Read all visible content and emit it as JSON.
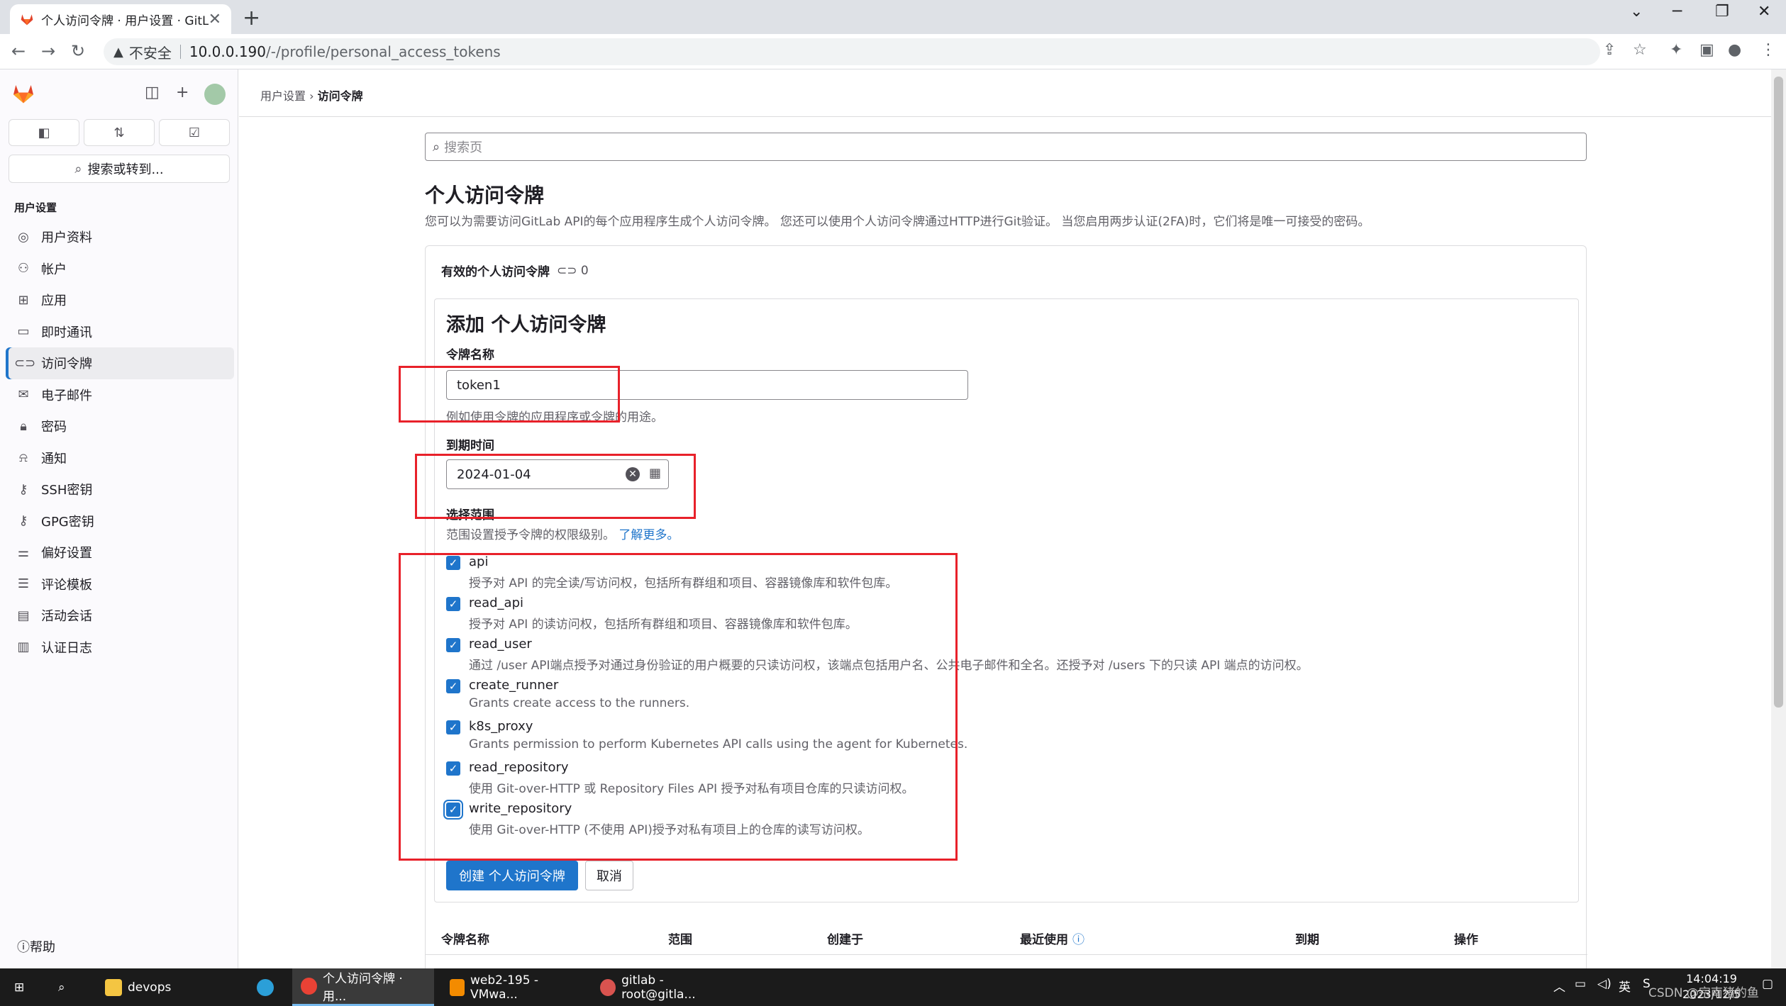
{
  "browser": {
    "tab_title": "个人访问令牌 · 用户设置 · GitLa",
    "tab_close": "✕",
    "new_tab": "+",
    "security_label": "不安全",
    "url_host": "10.0.0.190",
    "url_path": "/-/profile/personal_access_tokens"
  },
  "sidebar": {
    "search_label": "搜索或转到...",
    "section_title": "用户设置",
    "items": [
      {
        "label": "用户资料",
        "icon": "profile-icon"
      },
      {
        "label": "帐户",
        "icon": "account-icon"
      },
      {
        "label": "应用",
        "icon": "applications-icon"
      },
      {
        "label": "即时通讯",
        "icon": "chat-icon"
      },
      {
        "label": "访问令牌",
        "icon": "token-icon"
      },
      {
        "label": "电子邮件",
        "icon": "email-icon"
      },
      {
        "label": "密码",
        "icon": "lock-icon"
      },
      {
        "label": "通知",
        "icon": "bell-icon"
      },
      {
        "label": "SSH密钥",
        "icon": "key-icon"
      },
      {
        "label": "GPG密钥",
        "icon": "key-icon"
      },
      {
        "label": "偏好设置",
        "icon": "preferences-icon"
      },
      {
        "label": "评论模板",
        "icon": "comment-template-icon"
      },
      {
        "label": "活动会话",
        "icon": "sessions-icon"
      },
      {
        "label": "认证日志",
        "icon": "log-icon"
      }
    ],
    "active_index": 4,
    "help_label": "帮助"
  },
  "main": {
    "breadcrumb": {
      "parent": "用户设置",
      "current": "访问令牌"
    },
    "search_placeholder": "搜索页",
    "title": "个人访问令牌",
    "description": "您可以为需要访问GitLab API的每个应用程序生成个人访问令牌。 您还可以使用个人访问令牌通过HTTP进行Git验证。 当您启用两步认证(2FA)时，它们将是唯一可接受的密码。",
    "active_tokens_label": "有效的个人访问令牌",
    "active_tokens_count": "0",
    "form": {
      "title": "添加 个人访问令牌",
      "name_label": "令牌名称",
      "name_value": "token1",
      "name_help": "例如使用令牌的应用程序或令牌的用途。",
      "expiry_label": "到期时间",
      "expiry_value": "2024-01-04",
      "scopes_label": "选择范围",
      "scopes_help": "范围设置授予令牌的权限级别。",
      "scopes_link": "了解更多。",
      "scopes": [
        {
          "name": "api",
          "desc": "授予对 API 的完全读/写访问权，包括所有群组和项目、容器镜像库和软件包库。",
          "checked": true
        },
        {
          "name": "read_api",
          "desc": "授予对 API 的读访问权，包括所有群组和项目、容器镜像库和软件包库。",
          "checked": true
        },
        {
          "name": "read_user",
          "desc": "通过 /user API端点授予对通过身份验证的用户概要的只读访问权，该端点包括用户名、公共电子邮件和全名。还授予对 /users 下的只读 API 端点的访问权。",
          "checked": true
        },
        {
          "name": "create_runner",
          "desc": "Grants create access to the runners.",
          "checked": true
        },
        {
          "name": "k8s_proxy",
          "desc": "Grants permission to perform Kubernetes API calls using the agent for Kubernetes.",
          "checked": true
        },
        {
          "name": "read_repository",
          "desc": "使用 Git-over-HTTP 或 Repository Files API 授予对私有项目仓库的只读访问权。",
          "checked": true
        },
        {
          "name": "write_repository",
          "desc": "使用 Git-over-HTTP (不使用 API)授予对私有项目上的仓库的读写访问权。",
          "checked": true
        }
      ],
      "create_button": "创建 个人访问令牌",
      "cancel_button": "取消"
    },
    "table_headers": [
      "令牌名称",
      "范围",
      "创建于",
      "最近使用",
      "到期",
      "操作"
    ]
  },
  "taskbar": {
    "items": [
      "devops",
      "个人访问令牌 · 用...",
      "web2-195 - VMwa...",
      "gitlab - root@gitla..."
    ],
    "ime": "英",
    "time": "14:04:19",
    "date": "2023/12/5"
  },
  "watermark": "CSDN @宗南猪的鱼",
  "colors": {
    "accent": "#1f75cb",
    "annotation_red": "#e8212a"
  }
}
